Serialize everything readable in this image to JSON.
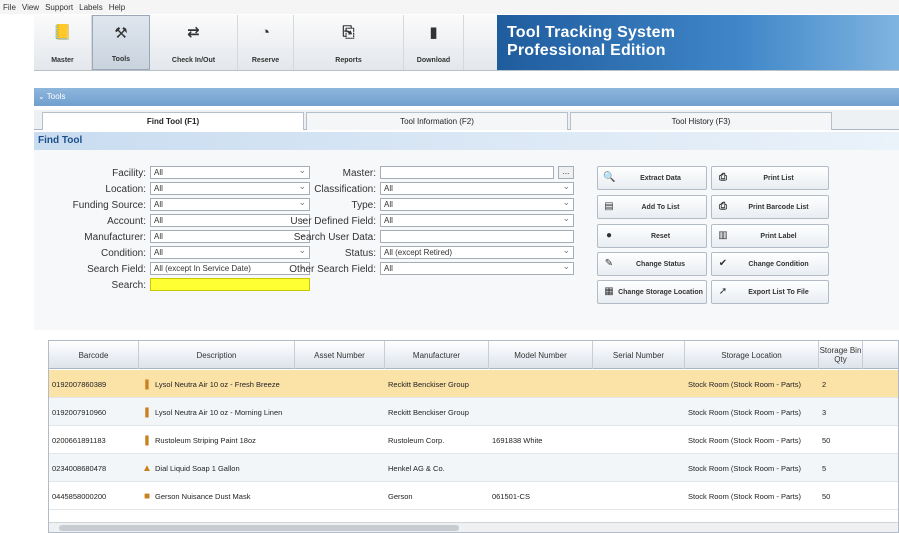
{
  "menu": [
    "File",
    "View",
    "Support",
    "Labels",
    "Help"
  ],
  "toolbar": {
    "buttons": [
      {
        "label": "Master",
        "icon": "master-icon",
        "glyph": "📒"
      },
      {
        "label": "Tools",
        "icon": "tools-icon",
        "glyph": "⚒"
      },
      {
        "label": "Check In/Out",
        "icon": "check-in-out-icon",
        "glyph": "⇄"
      },
      {
        "label": "Reserve",
        "icon": "reserve-icon",
        "glyph": "◔"
      },
      {
        "label": "Reports",
        "icon": "reports-icon",
        "glyph": "⎘"
      },
      {
        "label": "Download",
        "icon": "download-icon",
        "glyph": "▮"
      }
    ],
    "brand_line1": "Tool Tracking System",
    "brand_line2": "Professional Edition"
  },
  "window_title": "Tools",
  "tabs": [
    "Find Tool (F1)",
    "Tool Information (F2)",
    "Tool History (F3)"
  ],
  "panel_title": "Find Tool",
  "form": {
    "left": [
      {
        "label": "Facility:",
        "value": "All"
      },
      {
        "label": "Location:",
        "value": "All"
      },
      {
        "label": "Funding Source:",
        "value": "All"
      },
      {
        "label": "Account:",
        "value": "All"
      },
      {
        "label": "Manufacturer:",
        "value": "All"
      },
      {
        "label": "Condition:",
        "value": "All"
      },
      {
        "label": "Search Field:",
        "value": "All (except In Service Date)"
      },
      {
        "label": "Search:",
        "value": ""
      }
    ],
    "middle": [
      {
        "label": "Master:",
        "value": ""
      },
      {
        "label": "Classification:",
        "value": "All"
      },
      {
        "label": "Type:",
        "value": "All"
      },
      {
        "label": "User Defined Field:",
        "value": "All"
      },
      {
        "label": "Search User Data:",
        "value": ""
      },
      {
        "label": "Status:",
        "value": "All  (except Retired)"
      },
      {
        "label": "Other Search Field:",
        "value": "All"
      }
    ],
    "master_browse": "..."
  },
  "actions": {
    "col1": [
      {
        "label": "Extract Data",
        "icon": "extract-data-icon",
        "glyph": "🔍"
      },
      {
        "label": "Add To List",
        "icon": "add-to-list-icon",
        "glyph": "▤"
      },
      {
        "label": "Reset",
        "icon": "reset-icon",
        "glyph": "●"
      },
      {
        "label": "Change Status",
        "icon": "change-status-icon",
        "glyph": "✎"
      },
      {
        "label": "Change Storage Location",
        "icon": "change-storage-icon",
        "glyph": "▦"
      }
    ],
    "col2": [
      {
        "label": "Print List",
        "icon": "print-list-icon",
        "glyph": "⎙"
      },
      {
        "label": "Print Barcode List",
        "icon": "print-barcode-list-icon",
        "glyph": "⎙"
      },
      {
        "label": "Print Label",
        "icon": "print-label-icon",
        "glyph": "▥"
      },
      {
        "label": "Change Condition",
        "icon": "change-condition-icon",
        "glyph": "✔"
      },
      {
        "label": "Export List To File",
        "icon": "export-list-icon",
        "glyph": "➚"
      }
    ]
  },
  "grid": {
    "columns": [
      "Barcode",
      "Description",
      "Asset Number",
      "Manufacturer",
      "Model Number",
      "Serial Number",
      "Storage Location",
      "Storage Bin Qty"
    ],
    "rows": [
      {
        "barcode": "0192007860389",
        "description": "Lysol Neutra Air 10 oz - Fresh Breeze",
        "asset": "",
        "manufacturer": "Reckitt Benckiser Group",
        "model": "",
        "serial": "",
        "location": "Stock Room (Stock Room - Parts)",
        "qty": "2",
        "icon": "spray-can-icon",
        "glyph": "❚",
        "selected": true
      },
      {
        "barcode": "0192007910960",
        "description": "Lysol Neutra Air 10 oz - Morning Linen",
        "asset": "",
        "manufacturer": "Reckitt Benckiser Group",
        "model": "",
        "serial": "",
        "location": "Stock Room (Stock Room - Parts)",
        "qty": "3",
        "icon": "spray-can-icon",
        "glyph": "❚",
        "selected": false
      },
      {
        "barcode": "0200661891183",
        "description": "Rustoleum Striping Paint 18oz",
        "asset": "",
        "manufacturer": "Rustoleum Corp.",
        "model": "1691838 White",
        "serial": "",
        "location": "Stock Room (Stock Room - Parts)",
        "qty": "50",
        "icon": "paint-can-icon",
        "glyph": "❚",
        "selected": false
      },
      {
        "barcode": "0234008680478",
        "description": "Dial Liquid Soap 1 Gallon",
        "asset": "",
        "manufacturer": "Henkel AG & Co.",
        "model": "",
        "serial": "",
        "location": "Stock Room (Stock Room - Parts)",
        "qty": "5",
        "icon": "soap-bottle-icon",
        "glyph": "▲",
        "selected": false
      },
      {
        "barcode": "0445858000200",
        "description": "Gerson Nuisance Dust Mask",
        "asset": "",
        "manufacturer": "Gerson",
        "model": "061501-CS",
        "serial": "",
        "location": "Stock Room (Stock Room - Parts)",
        "qty": "50",
        "icon": "dust-mask-icon",
        "glyph": "■",
        "selected": false
      }
    ]
  }
}
